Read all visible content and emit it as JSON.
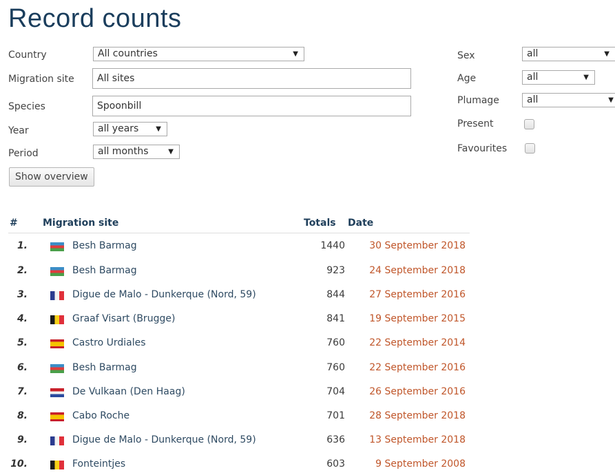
{
  "page": {
    "title": "Record counts"
  },
  "filters": {
    "country": {
      "label": "Country",
      "value": "All countries"
    },
    "migration_site": {
      "label": "Migration site",
      "value": "All sites"
    },
    "species": {
      "label": "Species",
      "value": "Spoonbill"
    },
    "year": {
      "label": "Year",
      "value": "all years"
    },
    "period": {
      "label": "Period",
      "value": "all months"
    },
    "sex": {
      "label": "Sex",
      "value": "all"
    },
    "age": {
      "label": "Age",
      "value": "all"
    },
    "plumage": {
      "label": "Plumage",
      "value": "all"
    },
    "present": {
      "label": "Present",
      "checked": false
    },
    "favourites": {
      "label": "Favourites",
      "checked": false
    },
    "show_overview_label": "Show overview"
  },
  "table": {
    "columns": {
      "rank": "#",
      "site": "Migration site",
      "totals": "Totals",
      "date": "Date"
    },
    "rows": [
      {
        "rank": "1.",
        "flag": "azerbaijan-flag-icon",
        "site": "Besh Barmag",
        "total": "1440",
        "date": "30 September 2018"
      },
      {
        "rank": "2.",
        "flag": "azerbaijan-flag-icon",
        "site": "Besh Barmag",
        "total": "923",
        "date": "24 September 2018"
      },
      {
        "rank": "3.",
        "flag": "france-flag-icon",
        "site": "Digue de Malo - Dunkerque (Nord, 59)",
        "total": "844",
        "date": "27 September 2016"
      },
      {
        "rank": "4.",
        "flag": "belgium-flag-icon",
        "site": "Graaf Visart (Brugge)",
        "total": "841",
        "date": "19 September 2015"
      },
      {
        "rank": "5.",
        "flag": "spain-flag-icon",
        "site": "Castro Urdiales",
        "total": "760",
        "date": "22 September 2014"
      },
      {
        "rank": "6.",
        "flag": "azerbaijan-flag-icon",
        "site": "Besh Barmag",
        "total": "760",
        "date": "22 September 2016"
      },
      {
        "rank": "7.",
        "flag": "netherlands-flag-icon",
        "site": "De Vulkaan (Den Haag)",
        "total": "704",
        "date": "26 September 2016"
      },
      {
        "rank": "8.",
        "flag": "spain-flag-icon",
        "site": "Cabo Roche",
        "total": "701",
        "date": "28 September 2018"
      },
      {
        "rank": "9.",
        "flag": "france-flag-icon",
        "site": "Digue de Malo - Dunkerque (Nord, 59)",
        "total": "636",
        "date": "13 September 2018"
      },
      {
        "rank": "10.",
        "flag": "belgium-flag-icon",
        "site": "Fonteintjes",
        "total": "603",
        "date": "9 September 2008"
      }
    ]
  }
}
